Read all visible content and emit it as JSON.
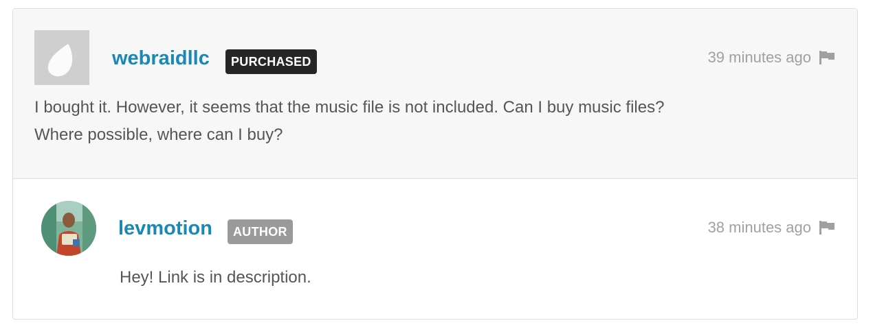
{
  "comments": [
    {
      "username": "webraidllc",
      "badge": "PURCHASED",
      "timestamp": "39 minutes ago",
      "avatar_icon": "envato-leaf-icon",
      "body_lines": [
        "I bought it. However, it seems that the music file is not included. Can I buy music files?",
        "Where possible, where can I buy?"
      ]
    },
    {
      "username": "levmotion",
      "badge": "AUTHOR",
      "timestamp": "38 minutes ago",
      "avatar_icon": "user-photo-avatar",
      "body_lines": [
        "Hey! Link is in description."
      ]
    }
  ],
  "colors": {
    "username": "#1a87b4",
    "badge_purchased": "#262626",
    "badge_author": "#9a9a9a",
    "timestamp": "#a0a0a0",
    "body_text": "#555555",
    "main_bg": "#f7f7f7",
    "border": "#dedede"
  },
  "icons": {
    "flag": "flag-icon"
  }
}
